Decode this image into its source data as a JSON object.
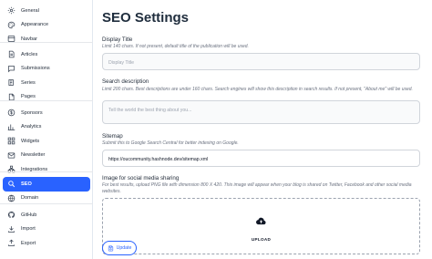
{
  "sidebar": {
    "groups": [
      [
        {
          "label": "General",
          "icon": "gear-icon"
        },
        {
          "label": "Appearance",
          "icon": "palette-icon"
        },
        {
          "label": "Navbar",
          "icon": "navbar-icon"
        }
      ],
      [
        {
          "label": "Articles",
          "icon": "article-icon"
        },
        {
          "label": "Submissions",
          "icon": "submissions-icon"
        },
        {
          "label": "Series",
          "icon": "series-icon"
        },
        {
          "label": "Pages",
          "icon": "page-icon"
        }
      ],
      [
        {
          "label": "Sponsors",
          "icon": "sponsor-icon"
        },
        {
          "label": "Analytics",
          "icon": "analytics-icon"
        },
        {
          "label": "Widgets",
          "icon": "widgets-icon"
        },
        {
          "label": "Newsletter",
          "icon": "newsletter-icon"
        },
        {
          "label": "Integrations",
          "icon": "integrations-icon"
        }
      ],
      [
        {
          "label": "SEO",
          "icon": "seo-icon",
          "active": true
        },
        {
          "label": "Domain",
          "icon": "globe-icon"
        }
      ],
      [
        {
          "label": "GitHub",
          "icon": "github-icon"
        },
        {
          "label": "Import",
          "icon": "import-icon"
        },
        {
          "label": "Export",
          "icon": "export-icon"
        }
      ]
    ]
  },
  "main": {
    "title": "SEO Settings",
    "display_title": {
      "label": "Display Title",
      "help": "Limit 140 chars. If not present, default title of the publication will be used.",
      "placeholder": "Display Title"
    },
    "search_description": {
      "label": "Search description",
      "help": "Limit 200 chars. Best descriptions are under 160 chars. Search engines will show this description in search results. If not present, \"About me\" will be used.",
      "placeholder": "Tell the world the best thing about you..."
    },
    "sitemap": {
      "label": "Sitemap",
      "help": "Submit this to Google Search Central for better indexing on Google.",
      "value": "https://oucommunity.hashnode.dev/sitemap.xml"
    },
    "social_image": {
      "label": "Image for social media sharing",
      "help": "For best results, upload PNG file with dimension 800 X 420. This image will appear when your blog is shared on Twitter, Facebook and other social media websites.",
      "upload_label": "UPLOAD"
    },
    "update_button": "Update"
  },
  "colors": {
    "accent": "#2962ff",
    "active_text": "#ffffff",
    "border": "#d1d5db"
  }
}
